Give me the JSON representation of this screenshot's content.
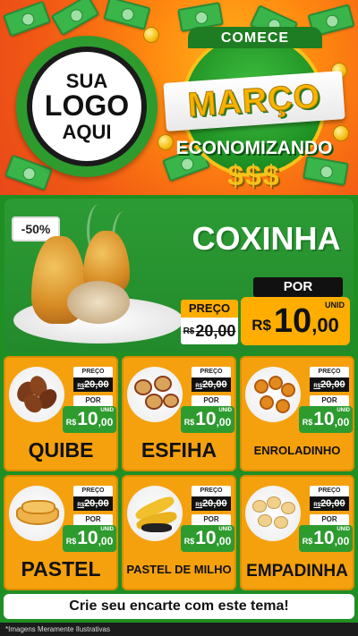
{
  "header": {
    "logo_lines": [
      "SUA",
      "LOGO",
      "AQUI"
    ],
    "campaign_top": "COMECE",
    "campaign_month": "MARÇO",
    "campaign_sub": "ECONOMIZANDO",
    "campaign_money": "$$$"
  },
  "featured": {
    "discount": "-50%",
    "name": "COXINHA",
    "price_label": "PREÇO",
    "old_currency": "R$",
    "old_price": "20,00",
    "por_label": "POR",
    "currency": "R$",
    "price_int": "10",
    "price_dec": ",00",
    "unit": "UNID"
  },
  "products": [
    {
      "name": "QUIBE",
      "preco_label": "PREÇO",
      "old_cur": "R$",
      "old_price": "20,00",
      "por_label": "POR",
      "cur": "R$",
      "int": "10",
      "dec": ",00",
      "unit": "UNID"
    },
    {
      "name": "ESFIHA",
      "preco_label": "PREÇO",
      "old_cur": "R$",
      "old_price": "20,00",
      "por_label": "POR",
      "cur": "R$",
      "int": "10",
      "dec": ",00",
      "unit": "UNID"
    },
    {
      "name": "ENROLADINHO",
      "preco_label": "PREÇO",
      "old_cur": "R$",
      "old_price": "20,00",
      "por_label": "POR",
      "cur": "R$",
      "int": "10",
      "dec": ",00",
      "unit": "UNID"
    },
    {
      "name": "PASTEL",
      "preco_label": "PREÇO",
      "old_cur": "R$",
      "old_price": "20,00",
      "por_label": "POR",
      "cur": "R$",
      "int": "10",
      "dec": ",00",
      "unit": "UNID"
    },
    {
      "name": "PASTEL DE MILHO",
      "preco_label": "PREÇO",
      "old_cur": "R$",
      "old_price": "20,00",
      "por_label": "POR",
      "cur": "R$",
      "int": "10",
      "dec": ",00",
      "unit": "UNID"
    },
    {
      "name": "EMPADINHA",
      "preco_label": "PREÇO",
      "old_cur": "R$",
      "old_price": "20,00",
      "por_label": "POR",
      "cur": "R$",
      "int": "10",
      "dec": ",00",
      "unit": "UNID"
    }
  ],
  "footer": {
    "cta": "Crie seu encarte com este tema!",
    "disclaimer": "*Imagens Meramente Ilustrativas"
  },
  "colors": {
    "green": "#2e9b2f",
    "orange": "#f5a10e",
    "gold": "#ffae00"
  }
}
